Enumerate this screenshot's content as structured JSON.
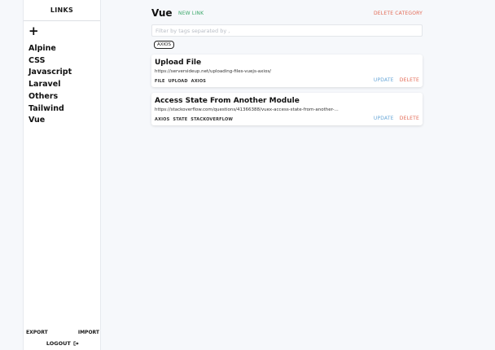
{
  "sidebar": {
    "title": "LINKS",
    "add_label": "+",
    "categories": [
      "Alpine",
      "CSS",
      "Javascript",
      "Laravel",
      "Others",
      "Tailwind",
      "Vue"
    ],
    "export_label": "EXPORT",
    "import_label": "IMPORT",
    "logout_label": "LOGOUT"
  },
  "main": {
    "title": "Vue",
    "new_link_label": "NEW LINK",
    "delete_category_label": "DELETE CATEGORY",
    "search_placeholder": "Filter by tags separated by ,",
    "active_tag": "AXIOS",
    "links": [
      {
        "title": "Upload File",
        "url": "https://serversideup.net/uploading-files-vuejs-axios/",
        "tags": [
          "FILE",
          "UPLOAD",
          "AXIOS"
        ],
        "update_label": "UPDATE",
        "delete_label": "DELETE"
      },
      {
        "title": "Access State From Another Module",
        "url": "https://stackoverflow.com/questions/41366388/vuex-access-state-from-another-...",
        "tags": [
          "AXIOS",
          "STATE",
          "STACKOVERFLOW"
        ],
        "update_label": "UPDATE",
        "delete_label": "DELETE"
      }
    ]
  },
  "colors": {
    "accent_green": "#3ba86a",
    "danger": "#e36a55",
    "update_blue": "#6aa8d8",
    "background": "#f6f8fb"
  }
}
